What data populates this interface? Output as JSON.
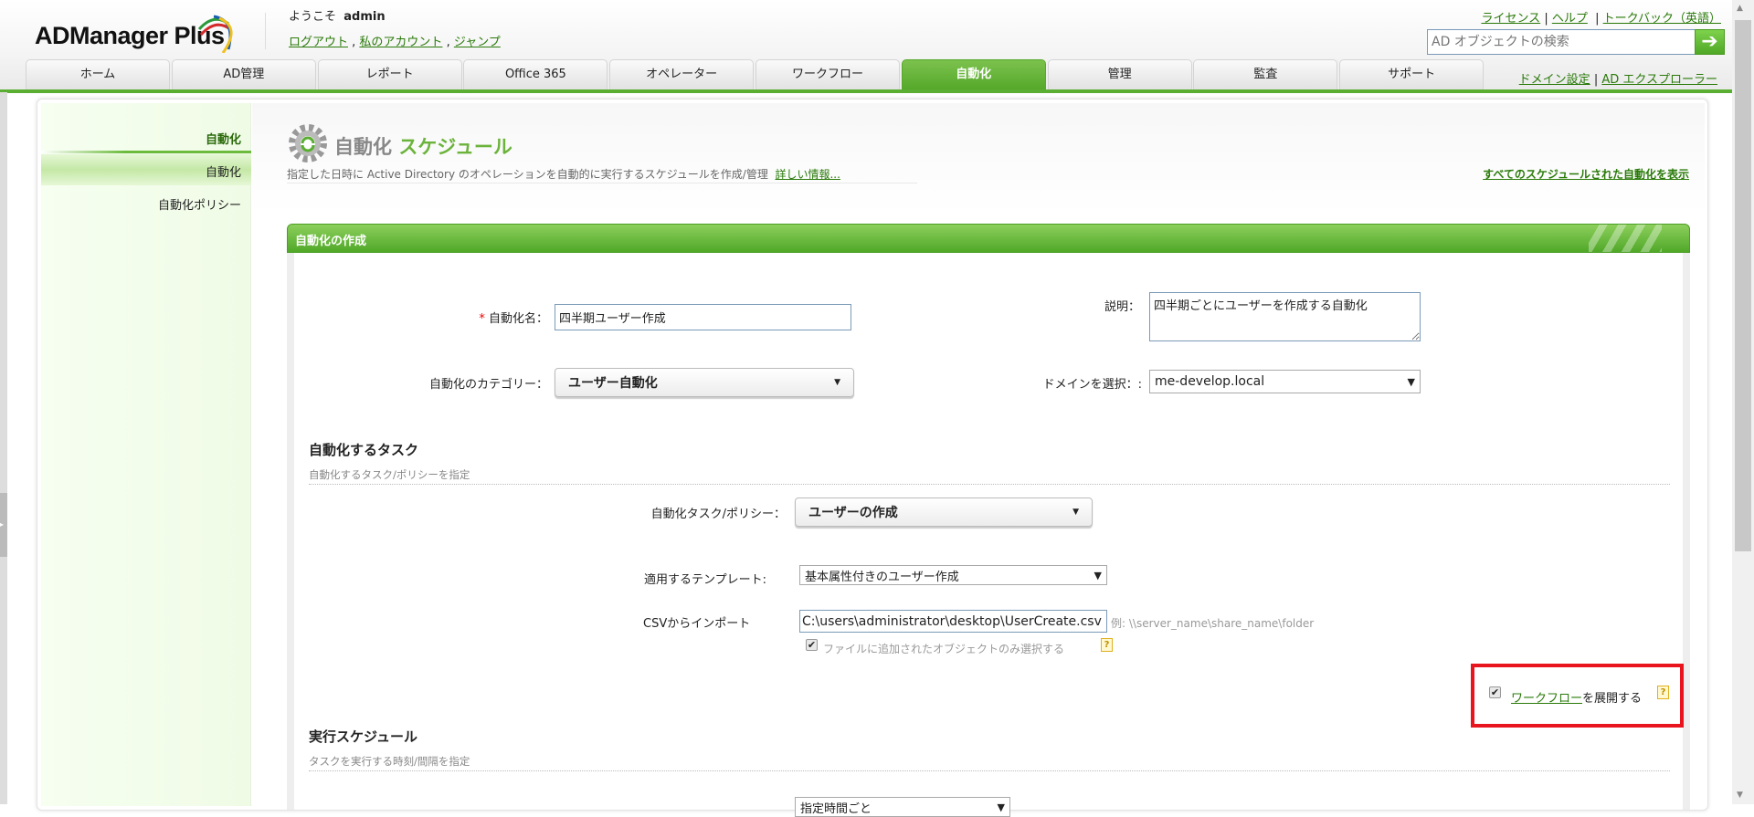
{
  "header": {
    "logo": "ADManager Plus",
    "welcome": "ようこそ",
    "user": "admin",
    "links": [
      "ログアウト",
      "私のアカウント",
      "ジャンプ"
    ],
    "top_right_links": [
      "ライセンス",
      "ヘルプ",
      "トークバック（英語）"
    ],
    "search_placeholder": "AD オブジェクトの検索",
    "sub_links": [
      "ドメイン設定",
      "AD エクスプローラー"
    ]
  },
  "tabs": [
    "ホーム",
    "AD管理",
    "レポート",
    "Office 365",
    "オペレーター",
    "ワークフロー",
    "自動化",
    "管理",
    "監査",
    "サポート"
  ],
  "active_tab": "自動化",
  "sidebar": {
    "heading": "自動化",
    "items": [
      "自動化",
      "自動化ポリシー"
    ]
  },
  "page": {
    "title_part1": "自動化",
    "title_part2": "スケジュール",
    "description": "指定した日時に Active Directory のオペレーションを自動的に実行するスケジュールを作成/管理",
    "more_info": "詳しい情報...",
    "view_all": "すべてのスケジュールされた自動化を表示"
  },
  "panel": {
    "title": "自動化の作成",
    "name_label": "自動化名：",
    "name_value": "四半期ユーザー作成",
    "desc_label": "説明：",
    "desc_value": "四半期ごとにユーザーを作成する自動化",
    "category_label": "自動化のカテゴリー：",
    "category_value": "ユーザー自動化",
    "domain_label": "ドメインを選択：:",
    "domain_value": "me-develop.local",
    "task_section": "自動化するタスク",
    "task_sub": "自動化するタスク/ポリシーを指定",
    "task_label": "自動化タスク/ポリシー：",
    "task_value": "ユーザーの作成",
    "template_label": "適用するテンプレート:",
    "template_value": "基本属性付きのユーザー作成",
    "csv_label": "CSVからインポート",
    "csv_value": "C:\\users\\administrator\\desktop\\UserCreate.csv",
    "csv_example": "例: \\\\server_name\\share_name\\folder",
    "only_file_objects": "ファイルに追加されたオブジェクトのみ選択する",
    "workflow_link": "ワークフロー",
    "workflow_suffix": "を展開する",
    "schedule_section": "実行スケジュール",
    "schedule_sub": "タスクを実行する時刻/間隔を指定",
    "schedule_value": "指定時間ごと"
  },
  "colors": {
    "brand_green": "#5aae32",
    "link": "#2a7a0a",
    "highlight": "#e8141e"
  }
}
